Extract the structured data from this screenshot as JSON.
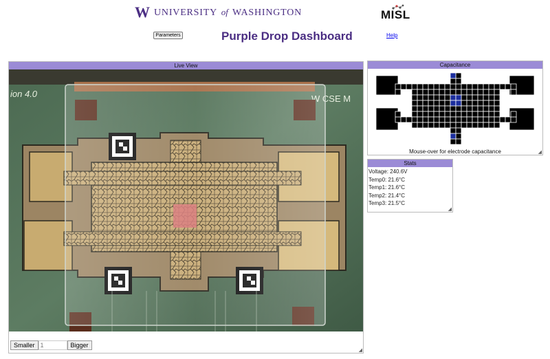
{
  "header": {
    "uw_logo_letter": "W",
    "uw_logo_line1": "UNIVERSITY",
    "uw_logo_of": "of",
    "uw_logo_line2": "WASHINGTON",
    "misl_logo": "MISL",
    "parameters_button": "Parameters",
    "title": "Purple Drop Dashboard",
    "help_link": "Help"
  },
  "live_view": {
    "heading": "Live View",
    "board_label": "ion 4.0",
    "board_label_right": "W CSE M",
    "zoom": {
      "smaller_label": "Smaller",
      "value": "1",
      "bigger_label": "Bigger"
    }
  },
  "capacitance": {
    "heading": "Capacitance",
    "caption": "Mouse-over for electrode capacitance",
    "colors": {
      "cell": "#000000",
      "active": "#1c2e9e",
      "border": "#ffffff"
    }
  },
  "stats": {
    "heading": "Stats",
    "lines": [
      "Voltage: 240.6V",
      "Temp0: 21.6°C",
      "Temp1: 21.6°C",
      "Temp2: 21.4°C",
      "Temp3: 21.5°C"
    ]
  },
  "colors": {
    "brand_purple": "#4b2e83",
    "panel_header": "#9b8bd6",
    "link": "#0000ee"
  }
}
